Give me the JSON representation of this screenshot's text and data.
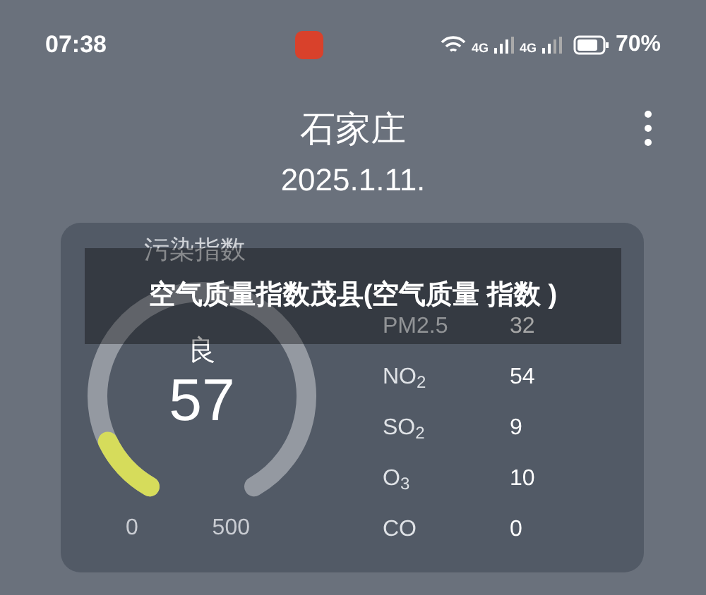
{
  "status_bar": {
    "time": "07:38",
    "network_1": "4G",
    "network_2": "4G",
    "battery": "70%"
  },
  "header": {
    "city": "石家庄",
    "date": "2025.1.11."
  },
  "card": {
    "label": "污染指数",
    "gauge": {
      "quality": "良",
      "value": "57",
      "min": "0",
      "max": "500"
    },
    "pollutants": [
      {
        "name": "PM2.5",
        "value": "32"
      },
      {
        "name": "NO$_{2}$",
        "value": "54"
      },
      {
        "name": "SO$_{2}$",
        "value": "9"
      },
      {
        "name": "O$_{3}$",
        "value": "10"
      },
      {
        "name": "CO",
        "value": "0"
      }
    ]
  },
  "overlay_caption": "空气质量指数茂县(空气质量 指数 )"
}
